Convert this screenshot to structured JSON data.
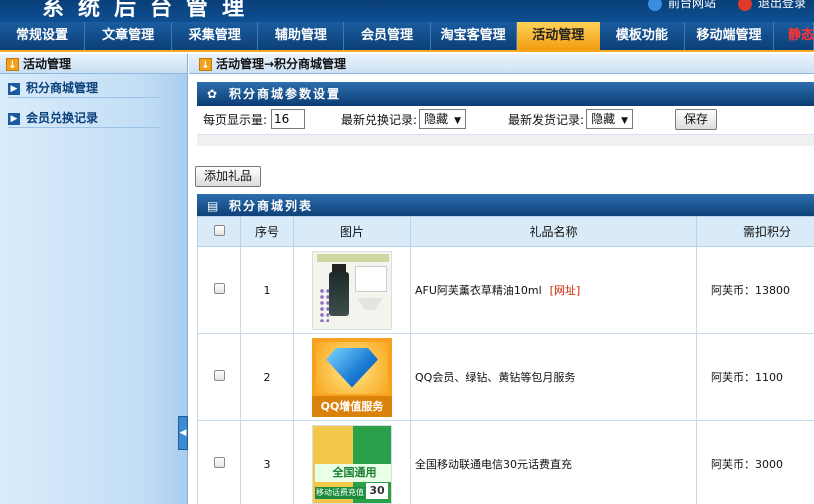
{
  "header": {
    "title": "系统后台管理",
    "top_links": [
      "前台网站",
      "退出登录"
    ]
  },
  "nav": {
    "items": [
      {
        "label": "常规设置"
      },
      {
        "label": "文章管理"
      },
      {
        "label": "采集管理"
      },
      {
        "label": "辅助管理"
      },
      {
        "label": "会员管理"
      },
      {
        "label": "淘宝客管理"
      },
      {
        "label": "活动管理",
        "active": true
      },
      {
        "label": "模板功能"
      },
      {
        "label": "移动端管理"
      },
      {
        "label": "静态"
      }
    ]
  },
  "sidebar": {
    "heading": "活动管理",
    "items": [
      {
        "label": "积分商城管理"
      },
      {
        "label": "会员兑换记录"
      }
    ]
  },
  "breadcrumb": "活动管理→积分商城管理",
  "settings_panel": {
    "title": "积分商城参数设置",
    "per_page_label": "每页显示量:",
    "per_page_value": "16",
    "latest_exchange_label": "最新兑换记录:",
    "latest_exchange_value": "隐藏",
    "latest_shipping_label": "最新发货记录:",
    "latest_shipping_value": "隐藏",
    "save_label": "保存"
  },
  "add_gift_label": "添加礼品",
  "list_panel": {
    "title": "积分商城列表",
    "columns": [
      "序号",
      "图片",
      "礼品名称",
      "需扣积分"
    ],
    "rows": [
      {
        "index": "1",
        "name": "AFU阿芙薰衣草精油10ml",
        "link": "[网址]",
        "points": "阿芙币：13800"
      },
      {
        "index": "2",
        "name": "QQ会员、绿钻、黄钻等包月服务",
        "link": "",
        "points": "阿芙币：1100",
        "image_text": "QQ增值服务"
      },
      {
        "index": "3",
        "name": "全国移动联通电信30元话费直充",
        "link": "",
        "points": "阿芙币：3000",
        "image_text": "全国通用",
        "image_num": "30",
        "image_strip": "移动话费充值"
      }
    ]
  },
  "colors": {
    "nav_bg": "#0b3f78",
    "nav_active": "#f29d10",
    "panel_head": "#0b3d73",
    "sidebar_bg": "#c3def5",
    "link_red": "#cc2200"
  }
}
